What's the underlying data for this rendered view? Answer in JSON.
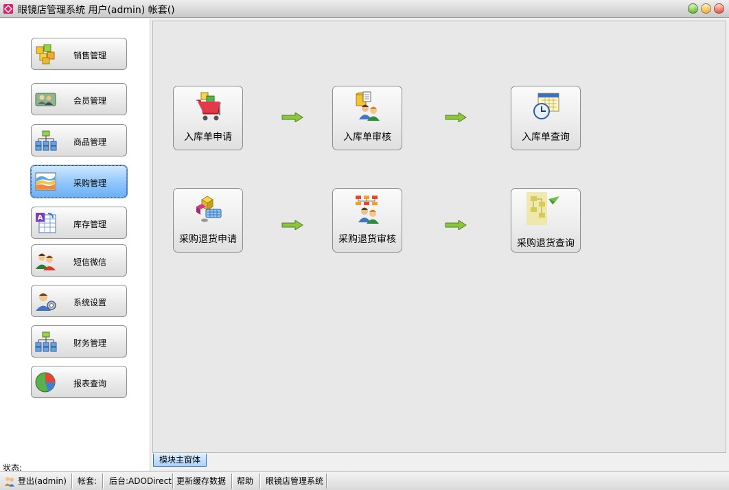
{
  "window": {
    "title": "眼镜店管理系统 用户(admin) 帐套()"
  },
  "sidebar": {
    "items": [
      {
        "label": "销售管理",
        "icon": "sales-cubes-icon"
      },
      {
        "label": "会员管理",
        "icon": "member-card-icon"
      },
      {
        "label": "商品管理",
        "icon": "product-tree-icon"
      },
      {
        "label": "采购管理",
        "icon": "purchase-chart-icon",
        "active": true
      },
      {
        "label": "库存管理",
        "icon": "inventory-table-icon"
      },
      {
        "label": "短信微信",
        "icon": "sms-users-icon"
      },
      {
        "label": "系统设置",
        "icon": "settings-user-icon"
      },
      {
        "label": "财务管理",
        "icon": "finance-tree-icon"
      },
      {
        "label": "报表查询",
        "icon": "report-pie-icon"
      }
    ],
    "status_label": "状态:"
  },
  "main": {
    "actions": [
      {
        "label": "入库单申请",
        "icon": "cart-icon"
      },
      {
        "label": "入库单审核",
        "icon": "audit-users-icon"
      },
      {
        "label": "入库单查询",
        "icon": "calendar-clock-icon"
      },
      {
        "label": "采购退货申请",
        "icon": "return-keyboard-icon"
      },
      {
        "label": "采购退货审核",
        "icon": "return-audit-icon"
      },
      {
        "label": "采购退货查询",
        "icon": "return-query-icon"
      }
    ],
    "tab": "模块主窗体"
  },
  "statusbar": {
    "logout": "登出(admin)",
    "account": "帐套:",
    "backend": "后台:ADODirect",
    "refresh_cache": "更新缓存数据",
    "help": "帮助",
    "app_name": "眼镜店管理系统"
  },
  "colors": {
    "accent": "#8fc6fb",
    "arrow": "#8cc63f",
    "panel": "#e8e8e8"
  }
}
